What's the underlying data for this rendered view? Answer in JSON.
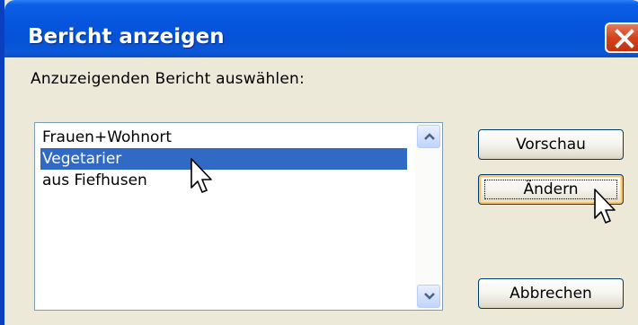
{
  "window": {
    "title": "Bericht anzeigen",
    "close_icon": "close-x-icon",
    "colors": {
      "titlebar": "#0655dc",
      "close": "#d5421c",
      "client": "#ece9d8",
      "selection": "#316ac5"
    }
  },
  "dialog": {
    "prompt": "Anzuzeigenden Bericht auswählen:",
    "reports": [
      {
        "label": "Frauen+Wohnort",
        "selected": false
      },
      {
        "label": "Vegetarier",
        "selected": true
      },
      {
        "label": "aus Fiefhusen",
        "selected": false
      }
    ],
    "buttons": {
      "preview": "Vorschau",
      "edit": "Ändern",
      "cancel": "Abbrechen"
    }
  },
  "cursors": [
    "arrow-cursor-icon",
    "arrow-cursor-icon"
  ]
}
